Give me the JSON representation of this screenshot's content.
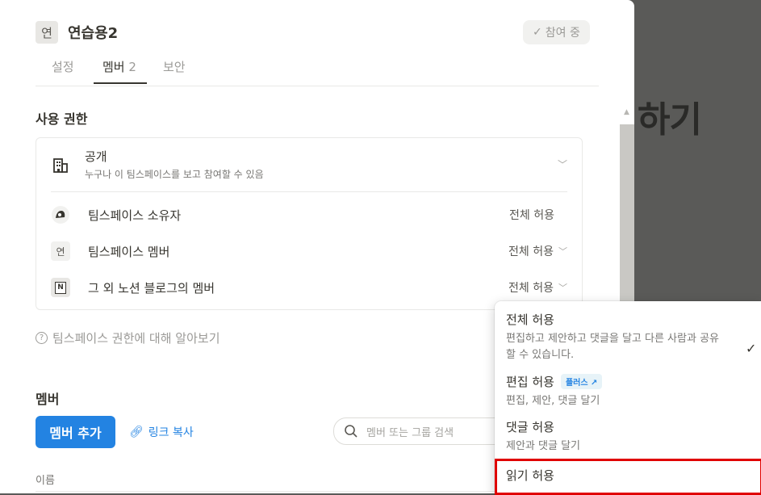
{
  "background": {
    "heading_fragment": "하기"
  },
  "workspace": {
    "avatar_char": "연",
    "name": "연습용2",
    "joined_label": "참여 중"
  },
  "tabs": [
    {
      "label": "설정",
      "count": ""
    },
    {
      "label": "멤버",
      "count": "2"
    },
    {
      "label": "보안",
      "count": ""
    }
  ],
  "permissions": {
    "title": "사용 권한",
    "public": {
      "title": "공개",
      "description": "누구나 이 팀스페이스를 보고 참여할 수 있음"
    },
    "rows": [
      {
        "icon": "owner-avatar-icon",
        "label": "팀스페이스 소유자",
        "access": "전체 허용"
      },
      {
        "icon_char": "연",
        "label": "팀스페이스 멤버",
        "access": "전체 허용"
      },
      {
        "icon": "notion-logo-icon",
        "icon_char": "N",
        "label": "그 외 노션 블로그의 멤버",
        "access": "전체 허용"
      }
    ],
    "learn_more": "팀스페이스 권한에 대해 알아보기"
  },
  "members": {
    "title": "멤버",
    "add_button": "멤버 추가",
    "copy_link": "링크 복사",
    "search_placeholder": "멤버 또는 그룹 검색",
    "name_column": "이름"
  },
  "dropdown": {
    "options": [
      {
        "title": "전체 허용",
        "description": "편집하고 제안하고 댓글을 달고 다른 사람과 공유할 수 있습니다.",
        "checked": true
      },
      {
        "title": "편집 허용",
        "badge": "플러스 ↗",
        "description": "편집, 제안, 댓글 달기"
      },
      {
        "title": "댓글 허용",
        "description": "제안과 댓글 달기"
      },
      {
        "title": "읽기 허용"
      }
    ]
  },
  "colors": {
    "accent": "#2383e2",
    "highlight": "#e00000"
  }
}
